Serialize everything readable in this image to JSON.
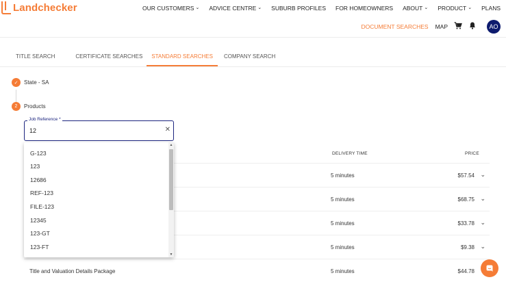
{
  "brand": {
    "name": "Landchecker",
    "color": "#f57c36"
  },
  "nav": {
    "items": [
      {
        "label": "OUR CUSTOMERS",
        "dropdown": true
      },
      {
        "label": "ADVICE CENTRE",
        "dropdown": true
      },
      {
        "label": "SUBURB PROFILES",
        "dropdown": false
      },
      {
        "label": "FOR HOMEOWNERS",
        "dropdown": false
      },
      {
        "label": "ABOUT",
        "dropdown": true
      },
      {
        "label": "PRODUCT",
        "dropdown": true
      },
      {
        "label": "PLANS",
        "dropdown": false
      }
    ],
    "chevron": "⌄"
  },
  "subnav": {
    "document_searches": "DOCUMENT SEARCHES",
    "map": "MAP",
    "cart_icon": "cart-icon",
    "bell_icon": "bell-icon",
    "avatar_initials": "AO"
  },
  "tabs": [
    {
      "label": "TITLE SEARCH",
      "active": false
    },
    {
      "label": "CERTIFICATE SEARCHES",
      "active": false
    },
    {
      "label": "STANDARD SEARCHES",
      "active": true
    },
    {
      "label": "COMPANY SEARCH",
      "active": false
    }
  ],
  "steps": [
    {
      "marker": "✓",
      "label": "State - SA"
    },
    {
      "marker": "2",
      "label": "Products"
    }
  ],
  "job_reference": {
    "label": "Job Reference *",
    "value": "12",
    "clear_icon": "✕"
  },
  "suggestions": [
    "G-123",
    "123",
    "12686",
    "REF-123",
    "FILE-123",
    "12345",
    "123-GT",
    "123-FT"
  ],
  "table": {
    "headers": {
      "delivery": "DELIVERY TIME",
      "price": "PRICE"
    },
    "rows": [
      {
        "name": "",
        "delivery": "5 minutes",
        "price": "$57.54"
      },
      {
        "name": "",
        "delivery": "5 minutes",
        "price": "$68.75"
      },
      {
        "name": "",
        "delivery": "5 minutes",
        "price": "$33.78"
      },
      {
        "name": "",
        "delivery": "5 minutes",
        "price": "$9.38"
      },
      {
        "name": "Title and Valuation Details Package",
        "delivery": "5 minutes",
        "price": "$44.78"
      }
    ],
    "row_chevron": "⌄"
  },
  "colors": {
    "accent": "#f57c36",
    "focus": "#1a237e",
    "avatar": "#0d1b6e"
  }
}
